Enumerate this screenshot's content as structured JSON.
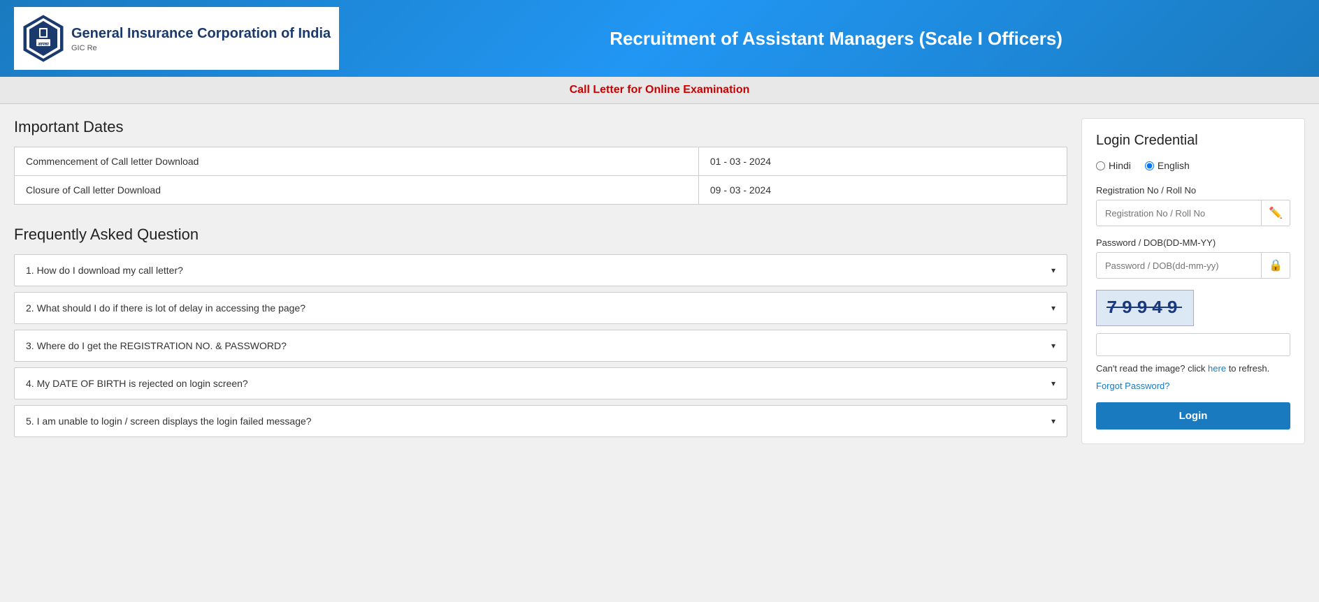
{
  "header": {
    "logo_title": "General Insurance Corporation of India",
    "logo_subtitle1": "GIC Re",
    "page_title": "Recruitment of Assistant Managers (Scale I Officers)"
  },
  "sub_header": {
    "text": "Call Letter for Online Examination"
  },
  "important_dates": {
    "section_title": "Important Dates",
    "rows": [
      {
        "label": "Commencement of Call letter Download",
        "value": "01 - 03 - 2024"
      },
      {
        "label": "Closure of Call letter Download",
        "value": "09 - 03 - 2024"
      }
    ]
  },
  "faq": {
    "section_title": "Frequently Asked Question",
    "items": [
      {
        "number": "1.",
        "text": "How do I download my call letter?"
      },
      {
        "number": "2.",
        "text": "What should I do if there is lot of delay in accessing the page?"
      },
      {
        "number": "3.",
        "text": "Where do I get the REGISTRATION NO. & PASSWORD?"
      },
      {
        "number": "4.",
        "text": "My DATE OF BIRTH is rejected on login screen?"
      },
      {
        "number": "5.",
        "text": "I am unable to login / screen displays the login failed message?"
      }
    ]
  },
  "login": {
    "title": "Login Credential",
    "lang_hindi": "Hindi",
    "lang_english": "English",
    "reg_label": "Registration No / Roll No",
    "reg_placeholder": "Registration No / Roll No",
    "pass_label": "Password / DOB(DD-MM-YY)",
    "pass_placeholder": "Password / DOB(dd-mm-yy)",
    "captcha_value": "79949",
    "captcha_refresh_text": "Can't read the image? click",
    "captcha_refresh_link": "here",
    "captcha_refresh_after": "to refresh.",
    "forgot_password": "Forgot Password?",
    "login_button": "Login"
  }
}
